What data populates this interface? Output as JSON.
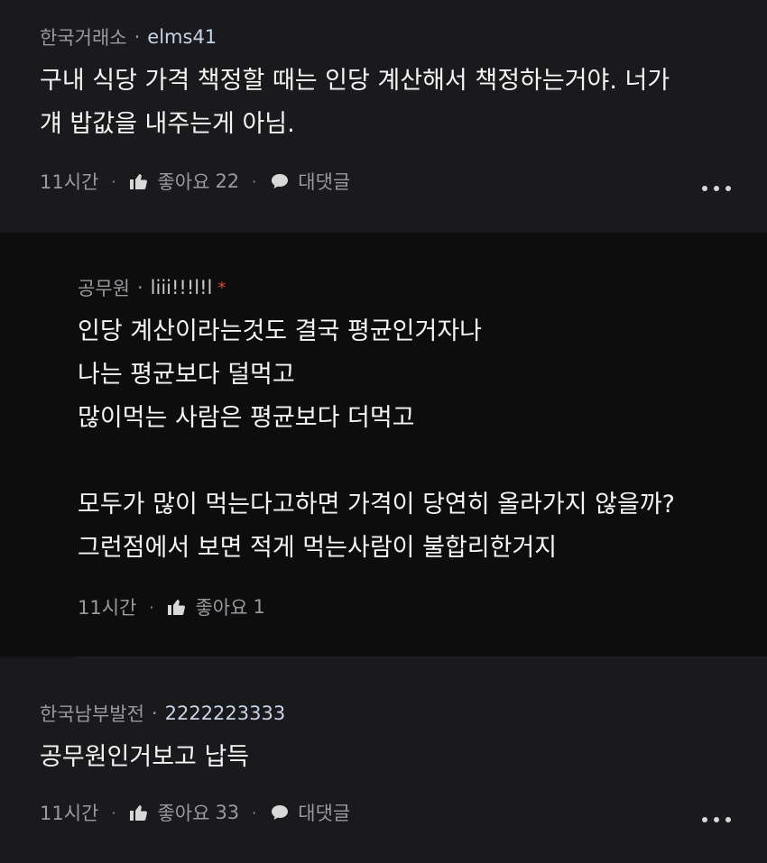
{
  "comments": [
    {
      "author": "한국거래소",
      "handle": "elms41",
      "lines": [
        "구내 식당 가격 책정할 때는 인당 계산해서 책정하는거야. 너가",
        "걔 밥값을 내주는게 아님."
      ],
      "time": "11시간",
      "like_label": "좋아요",
      "like_count": "22",
      "reply_label": "대댓글"
    },
    {
      "author": "공무원",
      "handle": "liii!!!l!l",
      "badge": "*",
      "lines": [
        "인당 계산이라는것도 결국 평균인거자나",
        "나는 평균보다 덜먹고",
        "많이먹는 사람은 평균보다 더먹고"
      ],
      "lines2": [
        "모두가 많이 먹는다고하면 가격이 당연히 올라가지 않을까?",
        "그런점에서 보면 적게 먹는사람이 불합리한거지"
      ],
      "time": "11시간",
      "like_label": "좋아요",
      "like_count": "1"
    },
    {
      "author": "한국남부발전",
      "handle": "2222223333",
      "lines": [
        "공무원인거보고 납득"
      ],
      "time": "11시간",
      "like_label": "좋아요",
      "like_count": "33",
      "reply_label": "대댓글"
    }
  ],
  "separator": "·",
  "icons": {
    "like": "thumbs-up-icon",
    "reply": "speech-bubble-icon",
    "more": "more-dots-icon"
  }
}
